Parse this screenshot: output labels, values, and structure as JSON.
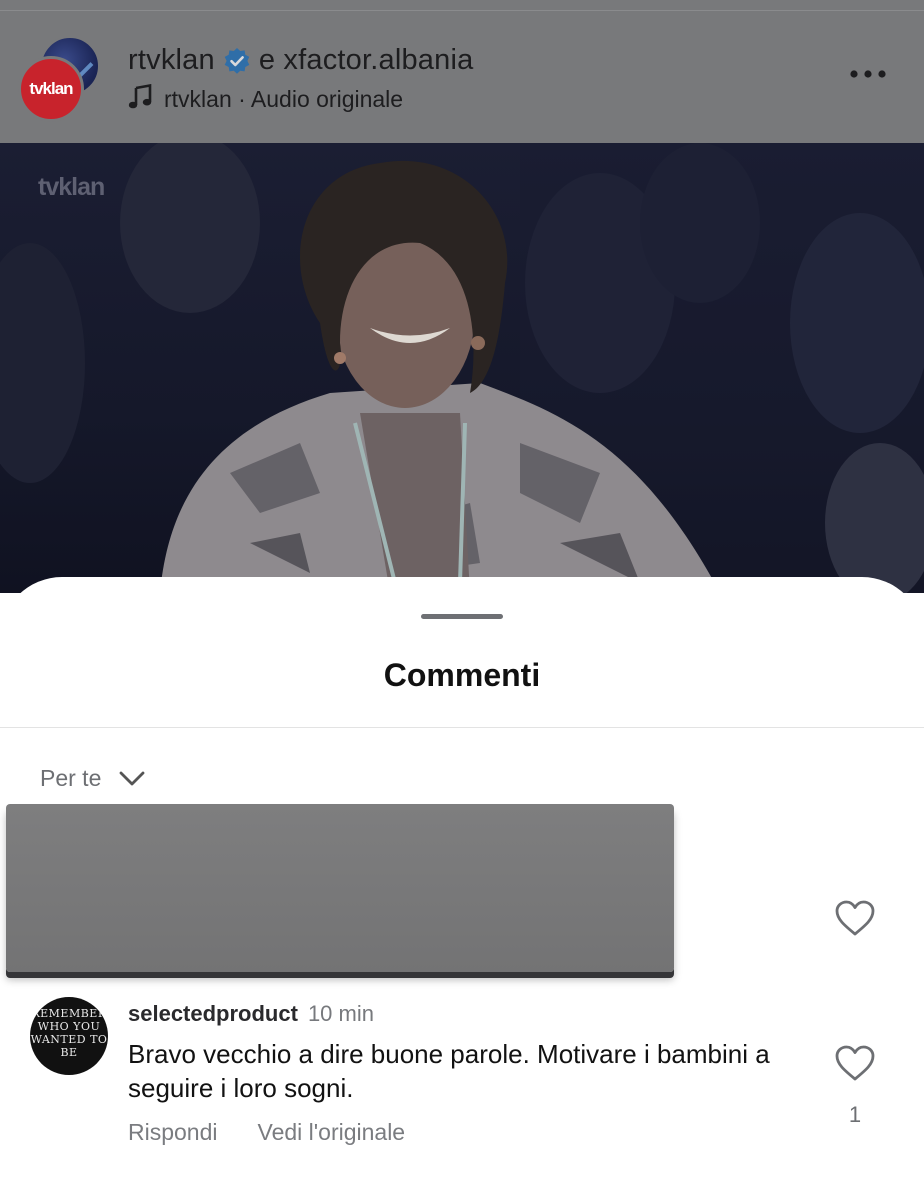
{
  "header": {
    "account": "rtvklan",
    "coauthor_text": "e xfactor.albania",
    "audio_text": "rtvklan · Audio originale",
    "logo_text": "tvklan",
    "icons": [
      "avatar",
      "verified-badge-icon",
      "music-note-icon",
      "more-options-icon"
    ]
  },
  "video": {
    "watermark": "tvklan"
  },
  "comments_sheet": {
    "title": "Commenti",
    "sort_label": "Per te",
    "comments": [
      {
        "avatar_text": "REMEMBER WHO YOU WANTED TO BE",
        "username": "selectedproduct",
        "time": "10 min",
        "text": "Bravo vecchio a dire buone parole. Motivare i bambini a seguire i loro sogni.",
        "reply_label": "Rispondi",
        "see_original_label": "Vedi l'originale",
        "like_count": "1"
      }
    ]
  },
  "colors": {
    "verified_blue": "#3797f0",
    "dim_overlay": "#78797b",
    "secondary_text": "#6d6f73"
  }
}
